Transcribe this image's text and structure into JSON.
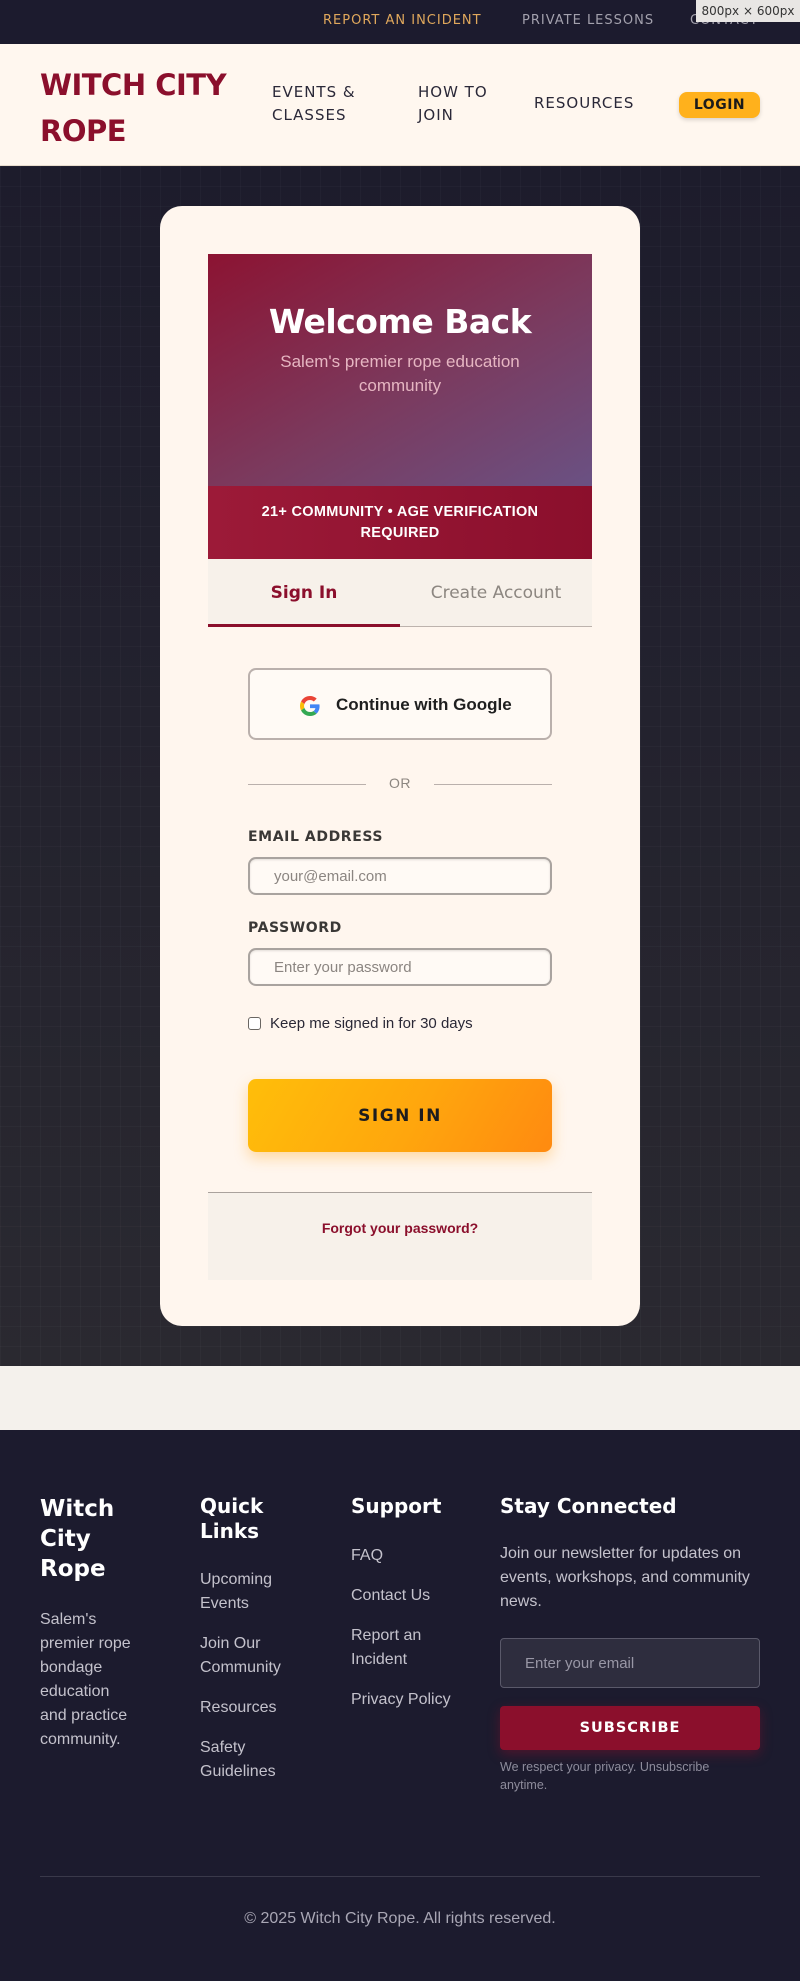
{
  "utility_nav": {
    "report_incident": "REPORT AN INCIDENT",
    "private_lessons": "PRIVATE LESSONS",
    "contact": "CONTACT"
  },
  "viewport_badge": "800px × 600px",
  "header": {
    "brand": "WITCH CITY ROPE",
    "nav": [
      "EVENTS & CLASSES",
      "HOW TO JOIN",
      "RESOURCES"
    ],
    "login_label": "LOGIN"
  },
  "auth_card": {
    "title": "Welcome Back",
    "subtitle": "Salem's premier rope education community",
    "age_notice": "21+ COMMUNITY • AGE VERIFICATION REQUIRED",
    "tabs": [
      "Sign In",
      "Create Account"
    ],
    "active_tab": "Sign In",
    "google_button": "Continue with Google",
    "divider": "OR",
    "email_label": "EMAIL ADDRESS",
    "email_placeholder": "your@email.com",
    "password_label": "PASSWORD",
    "password_placeholder": "Enter your password",
    "remember_label": "Keep me signed in for 30 days",
    "remember_checked": false,
    "submit_label": "SIGN IN",
    "forgot_label": "Forgot your password?"
  },
  "footer": {
    "brand": "Witch City Rope",
    "about": "Salem's premier rope bondage education and practice community.",
    "quick_links_title": "Quick Links",
    "quick_links": [
      "Upcoming Events",
      "Join Our Community",
      "Resources",
      "Safety Guidelines"
    ],
    "support_title": "Support",
    "support_links": [
      "FAQ",
      "Contact Us",
      "Report an Incident",
      "Privacy Policy"
    ],
    "stay_title": "Stay Connected",
    "stay_text": "Join our newsletter for updates on events, workshops, and community news.",
    "email_placeholder": "Enter your email",
    "subscribe_label": "SUBSCRIBE",
    "privacy_note": "We respect your privacy. Unsubscribe anytime.",
    "copyright": "© 2025 Witch City Rope. All rights reserved."
  },
  "colors": {
    "brand_crimson": "#8b0f2c",
    "accent_amber": "#ffb11c",
    "dark_navy": "#1c1b2e",
    "cream": "#fff6ee"
  }
}
